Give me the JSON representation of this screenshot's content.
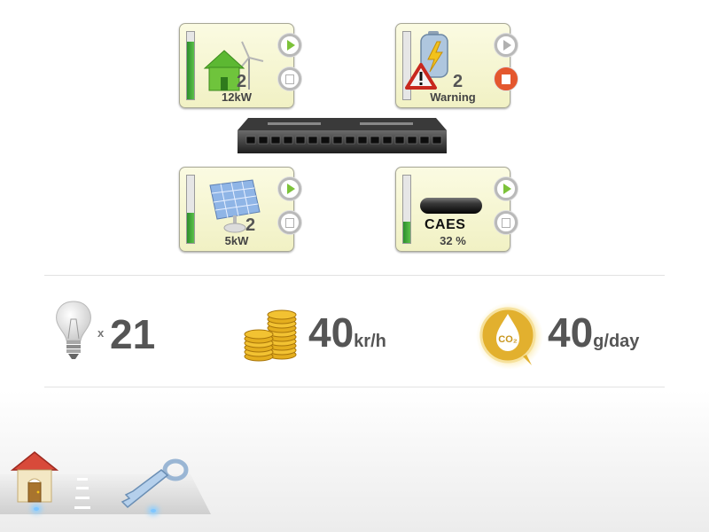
{
  "devices": {
    "wind_house": {
      "label": "12kW",
      "count": "2",
      "level": 0.85,
      "play_active": true,
      "stop_active": false,
      "icon": "wind-turbine-house-icon"
    },
    "battery": {
      "label": "Warning",
      "count": "2",
      "level": 0.0,
      "play_active": false,
      "stop_active": true,
      "icon": "battery-warning-icon"
    },
    "solar": {
      "label": "5kW",
      "count": "2",
      "level": 0.45,
      "play_active": true,
      "stop_active": false,
      "icon": "solar-panel-icon"
    },
    "caes": {
      "label": "32 %",
      "title": "CAES",
      "level": 0.32,
      "play_active": true,
      "stop_active": false,
      "icon": "compressed-air-tank-icon"
    }
  },
  "stats": {
    "bulbs": {
      "prefix": "x",
      "value": "21",
      "icon": "light-bulb-icon"
    },
    "cost": {
      "value": "40",
      "unit": "kr/h",
      "icon": "coins-icon"
    },
    "co2": {
      "value": "40",
      "unit": "g/day",
      "badge": "CO₂",
      "icon": "co2-drop-icon"
    }
  },
  "nav": {
    "home_icon": "home-icon",
    "key_icon": "key-icon"
  },
  "colors": {
    "card_bg": "#f3f3cc",
    "level_green": "#3caa3a",
    "play_green": "#7cc23a",
    "stop_red": "#e4572e",
    "text_grey": "#555555"
  }
}
